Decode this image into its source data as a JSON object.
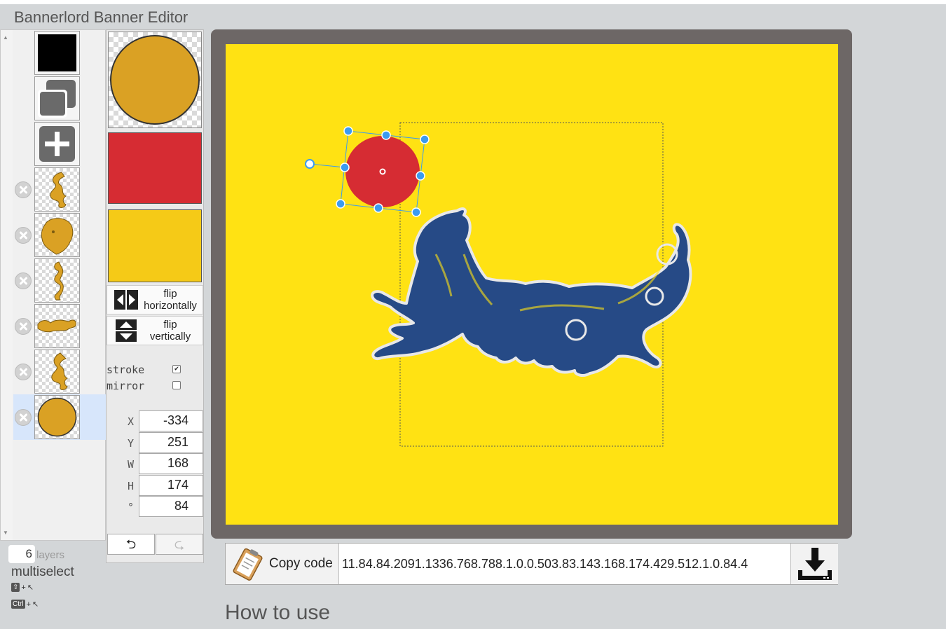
{
  "app": {
    "title": "Bannerlord Banner Editor"
  },
  "colors": {
    "background": "#ffe213",
    "primary": "#d62c33",
    "secondary": "#f5ca17",
    "emblem": "#daa124",
    "dragon": "#264a86",
    "frame": "#6d6766"
  },
  "layers": {
    "count": "6",
    "count_label": "layers",
    "top_controls": [
      {
        "name": "background-color-swatch",
        "icon": "black-square"
      },
      {
        "name": "duplicate-layer-button",
        "icon": "duplicate-icon"
      },
      {
        "name": "add-layer-button",
        "icon": "plus-icon"
      }
    ],
    "items": [
      {
        "icon": "dragon-rampant-icon",
        "delete_icon": "close-icon"
      },
      {
        "icon": "lion-head-icon",
        "delete_icon": "close-icon"
      },
      {
        "icon": "dragon-coiled-icon",
        "delete_icon": "close-icon"
      },
      {
        "icon": "dragon-passant-icon",
        "delete_icon": "close-icon"
      },
      {
        "icon": "dragon-rampant-icon",
        "delete_icon": "close-icon"
      },
      {
        "icon": "circle-icon",
        "delete_icon": "close-icon",
        "selected": true
      }
    ]
  },
  "multiselect": {
    "label": "multiselect",
    "shift_key": "⇧",
    "ctrl_key": "Ctrl",
    "plus": "+"
  },
  "editor": {
    "flip_h_line1": "flip",
    "flip_h_line2": "horizontally",
    "flip_v_line1": "flip",
    "flip_v_line2": "vertically",
    "stroke_label": "stroke",
    "stroke_checked": "✔",
    "mirror_label": "mirror",
    "mirror_checked": "",
    "fields": {
      "x_label": "X",
      "x_value": "-334",
      "y_label": "Y",
      "y_value": "251",
      "w_label": "W",
      "w_value": "168",
      "h_label": "H",
      "h_value": "174",
      "r_label": "°",
      "r_value": "84"
    },
    "undo": "⮌",
    "redo": "⮎"
  },
  "code": {
    "copy_label": "Copy code",
    "value": "11.84.84.2091.1336.768.788.1.0.0.503.83.143.168.174.429.512.1.0.84.4",
    "copy_icon": "clipboard-icon",
    "download_icon": "download-icon"
  },
  "how_to": {
    "heading": "How to use"
  }
}
